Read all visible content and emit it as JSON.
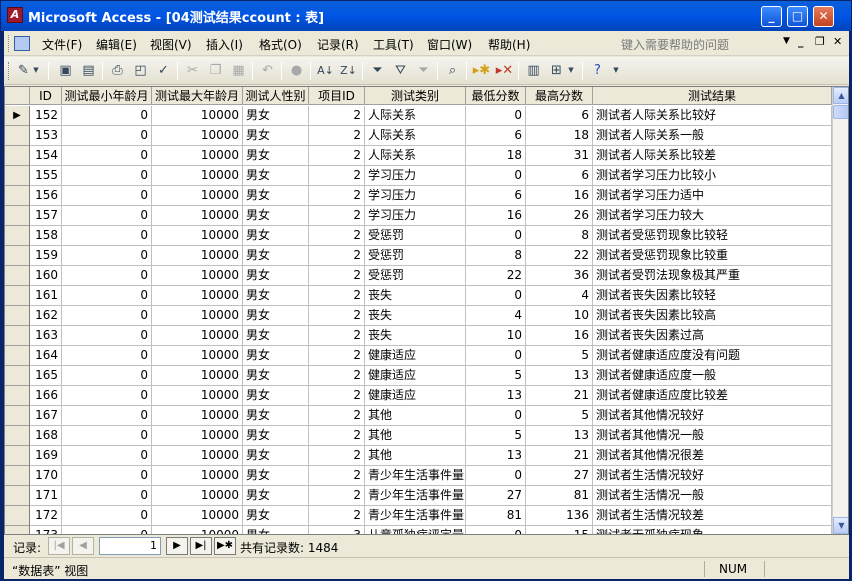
{
  "window": {
    "title": "Microsoft Access - [04测试结果ccount : 表]",
    "app_icon": "access-icon"
  },
  "menubar": {
    "items": [
      "文件(F)",
      "编辑(E)",
      "视图(V)",
      "插入(I)",
      "格式(O)",
      "记录(R)",
      "工具(T)",
      "窗口(W)",
      "帮助(H)"
    ],
    "help_placeholder": "键入需要帮助的问题"
  },
  "toolbar": {
    "icons": [
      "view-icon",
      "save-icon",
      "print-preview-icon",
      "print-icon",
      "page-preview-icon",
      "spelling-icon",
      "cut-icon",
      "copy-icon",
      "paste-icon",
      "undo-icon",
      "hyperlink-icon",
      "sort-ascending-icon",
      "sort-descending-icon",
      "filter-by-selection-icon",
      "filter-by-form-icon",
      "apply-filter-icon",
      "find-icon",
      "new-record-icon",
      "delete-record-icon",
      "database-window-icon",
      "new-object-icon",
      "help-icon"
    ]
  },
  "grid": {
    "columns": [
      "ID",
      "测试最小年龄月",
      "测试最大年龄月",
      "测试人性别",
      "项目ID",
      "测试类别",
      "最低分数",
      "最高分数",
      "测试结果"
    ],
    "rows": [
      [
        "152",
        "0",
        "10000",
        "男女",
        "2",
        "人际关系",
        "0",
        "6",
        "测试者人际关系比较好"
      ],
      [
        "153",
        "0",
        "10000",
        "男女",
        "2",
        "人际关系",
        "6",
        "18",
        "测试者人际关系一般"
      ],
      [
        "154",
        "0",
        "10000",
        "男女",
        "2",
        "人际关系",
        "18",
        "31",
        "测试者人际关系比较差"
      ],
      [
        "155",
        "0",
        "10000",
        "男女",
        "2",
        "学习压力",
        "0",
        "6",
        "测试者学习压力比较小"
      ],
      [
        "156",
        "0",
        "10000",
        "男女",
        "2",
        "学习压力",
        "6",
        "16",
        "测试者学习压力适中"
      ],
      [
        "157",
        "0",
        "10000",
        "男女",
        "2",
        "学习压力",
        "16",
        "26",
        "测试者学习压力较大"
      ],
      [
        "158",
        "0",
        "10000",
        "男女",
        "2",
        "受惩罚",
        "0",
        "8",
        "测试者受惩罚现象比较轻"
      ],
      [
        "159",
        "0",
        "10000",
        "男女",
        "2",
        "受惩罚",
        "8",
        "22",
        "测试者受惩罚现象比较重"
      ],
      [
        "160",
        "0",
        "10000",
        "男女",
        "2",
        "受惩罚",
        "22",
        "36",
        "测试者受罚法现象极其严重"
      ],
      [
        "161",
        "0",
        "10000",
        "男女",
        "2",
        "丧失",
        "0",
        "4",
        "测试者丧失因素比较轻"
      ],
      [
        "162",
        "0",
        "10000",
        "男女",
        "2",
        "丧失",
        "4",
        "10",
        "测试者丧失因素比较高"
      ],
      [
        "163",
        "0",
        "10000",
        "男女",
        "2",
        "丧失",
        "10",
        "16",
        "测试者丧失因素过高"
      ],
      [
        "164",
        "0",
        "10000",
        "男女",
        "2",
        "健康适应",
        "0",
        "5",
        "测试者健康适应度没有问题"
      ],
      [
        "165",
        "0",
        "10000",
        "男女",
        "2",
        "健康适应",
        "5",
        "13",
        "测试者健康适应度一般"
      ],
      [
        "166",
        "0",
        "10000",
        "男女",
        "2",
        "健康适应",
        "13",
        "21",
        "测试者健康适应度比较差"
      ],
      [
        "167",
        "0",
        "10000",
        "男女",
        "2",
        "其他",
        "0",
        "5",
        "测试者其他情况较好"
      ],
      [
        "168",
        "0",
        "10000",
        "男女",
        "2",
        "其他",
        "5",
        "13",
        "测试者其他情况一般"
      ],
      [
        "169",
        "0",
        "10000",
        "男女",
        "2",
        "其他",
        "13",
        "21",
        "测试者其他情况很差"
      ],
      [
        "170",
        "0",
        "10000",
        "男女",
        "2",
        "青少年生活事件量",
        "0",
        "27",
        "测试者生活情况较好"
      ],
      [
        "171",
        "0",
        "10000",
        "男女",
        "2",
        "青少年生活事件量",
        "27",
        "81",
        "测试者生活情况一般"
      ],
      [
        "172",
        "0",
        "10000",
        "男女",
        "2",
        "青少年生活事件量",
        "81",
        "136",
        "测试者生活情况较差"
      ],
      [
        "173",
        "0",
        "10000",
        "男女",
        "3",
        "儿童孤独症评定量",
        "0",
        "15",
        "测试者无孤独症现象"
      ]
    ]
  },
  "navbar": {
    "label": "记录:",
    "current": "1",
    "total_text": "共有记录数: 1484"
  },
  "statusbar": {
    "text": "“数据表” 视图",
    "num": "NUM"
  }
}
